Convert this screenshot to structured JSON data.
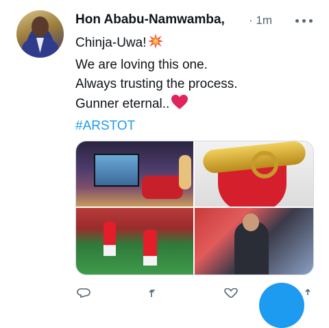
{
  "tweet": {
    "author_name": "Hon Ababu-Namwamba,",
    "timestamp": "· 1m",
    "lines": [
      "Chinja-Uwa!",
      "We are loving this one.",
      "Always trusting the process.",
      "Gunner eternal.."
    ],
    "hashtag": "#ARSTOT",
    "emojis": [
      "collision-icon",
      "red-heart-icon"
    ]
  },
  "actions": {
    "reply_count": "",
    "retweet_count": "",
    "like_count": ""
  },
  "colors": {
    "accent": "#1d9bf0",
    "text": "#0f1419",
    "muted": "#536471",
    "border": "#cfd9de",
    "heart": "#e0245e"
  }
}
